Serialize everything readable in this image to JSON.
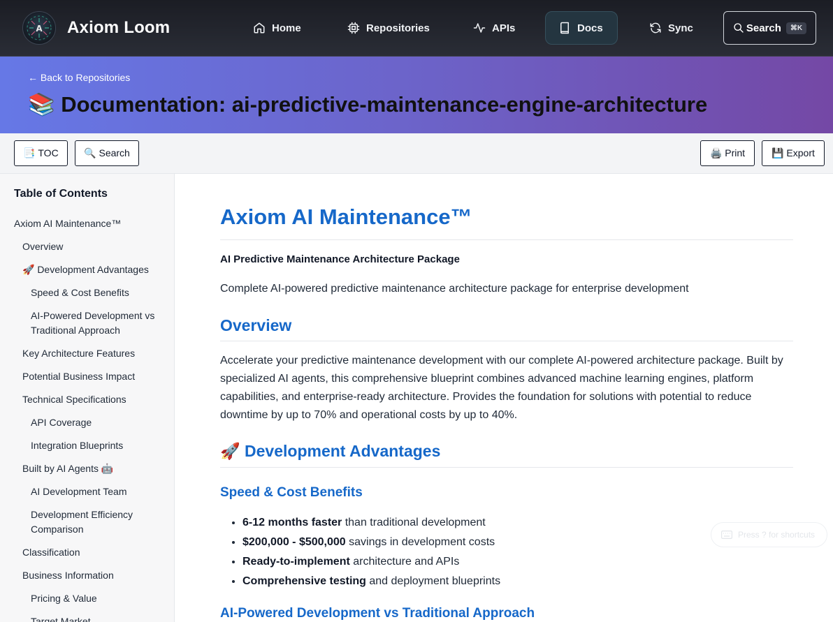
{
  "app": {
    "name": "Axiom Loom"
  },
  "nav": {
    "items": [
      {
        "label": "Home",
        "icon": "home-icon"
      },
      {
        "label": "Repositories",
        "icon": "chip-icon"
      },
      {
        "label": "APIs",
        "icon": "activity-icon"
      },
      {
        "label": "Docs",
        "icon": "book-icon",
        "active": true
      },
      {
        "label": "Sync",
        "icon": "refresh-icon"
      }
    ],
    "search_label": "Search",
    "search_shortcut": "⌘K"
  },
  "hero": {
    "back_link": "← Back to Repositories",
    "title": "📚 Documentation: ai-predictive-maintenance-engine-architecture"
  },
  "toolbar": {
    "toc_label": "📑 TOC",
    "search_label": "🔍 Search",
    "print_label": "🖨️ Print",
    "export_label": "💾 Export"
  },
  "toc": {
    "heading": "Table of Contents",
    "items": [
      {
        "label": "Axiom AI Maintenance™",
        "level": 1
      },
      {
        "label": "Overview",
        "level": 2
      },
      {
        "label": "🚀 Development Advantages",
        "level": 2
      },
      {
        "label": "Speed & Cost Benefits",
        "level": 3
      },
      {
        "label": "AI-Powered Development vs Traditional Approach",
        "level": 3
      },
      {
        "label": "Key Architecture Features",
        "level": 2
      },
      {
        "label": "Potential Business Impact",
        "level": 2
      },
      {
        "label": "Technical Specifications",
        "level": 2
      },
      {
        "label": "API Coverage",
        "level": 3
      },
      {
        "label": "Integration Blueprints",
        "level": 3
      },
      {
        "label": "Built by AI Agents 🤖",
        "level": 2
      },
      {
        "label": "AI Development Team",
        "level": 3
      },
      {
        "label": "Development Efficiency Comparison",
        "level": 3
      },
      {
        "label": "Classification",
        "level": 2
      },
      {
        "label": "Business Information",
        "level": 2
      },
      {
        "label": "Pricing & Value",
        "level": 3
      },
      {
        "label": "Target Market",
        "level": 3
      }
    ]
  },
  "doc": {
    "h1": "Axiom AI Maintenance™",
    "subtitle": "AI Predictive Maintenance Architecture Package",
    "intro": "Complete AI-powered predictive maintenance architecture package for enterprise development",
    "overview_heading": "Overview",
    "overview_text": "Accelerate your predictive maintenance development with our complete AI-powered architecture package. Built by specialized AI agents, this comprehensive blueprint combines advanced machine learning engines, platform capabilities, and enterprise-ready architecture. Provides the foundation for solutions with potential to reduce downtime by up to 70% and operational costs by up to 40%.",
    "advantages_heading": "🚀 Development Advantages",
    "speed_heading": "Speed & Cost Benefits",
    "bullets": [
      {
        "bold": "6-12 months faster",
        "rest": " than traditional development"
      },
      {
        "bold": "$200,000 - $500,000",
        "rest": " savings in development costs"
      },
      {
        "bold": "Ready-to-implement",
        "rest": " architecture and APIs"
      },
      {
        "bold": "Comprehensive testing",
        "rest": " and deployment blueprints"
      }
    ],
    "comparison_heading": "AI-Powered Development vs Traditional Approach"
  },
  "shortcut_hint": "Press ? for shortcuts"
}
